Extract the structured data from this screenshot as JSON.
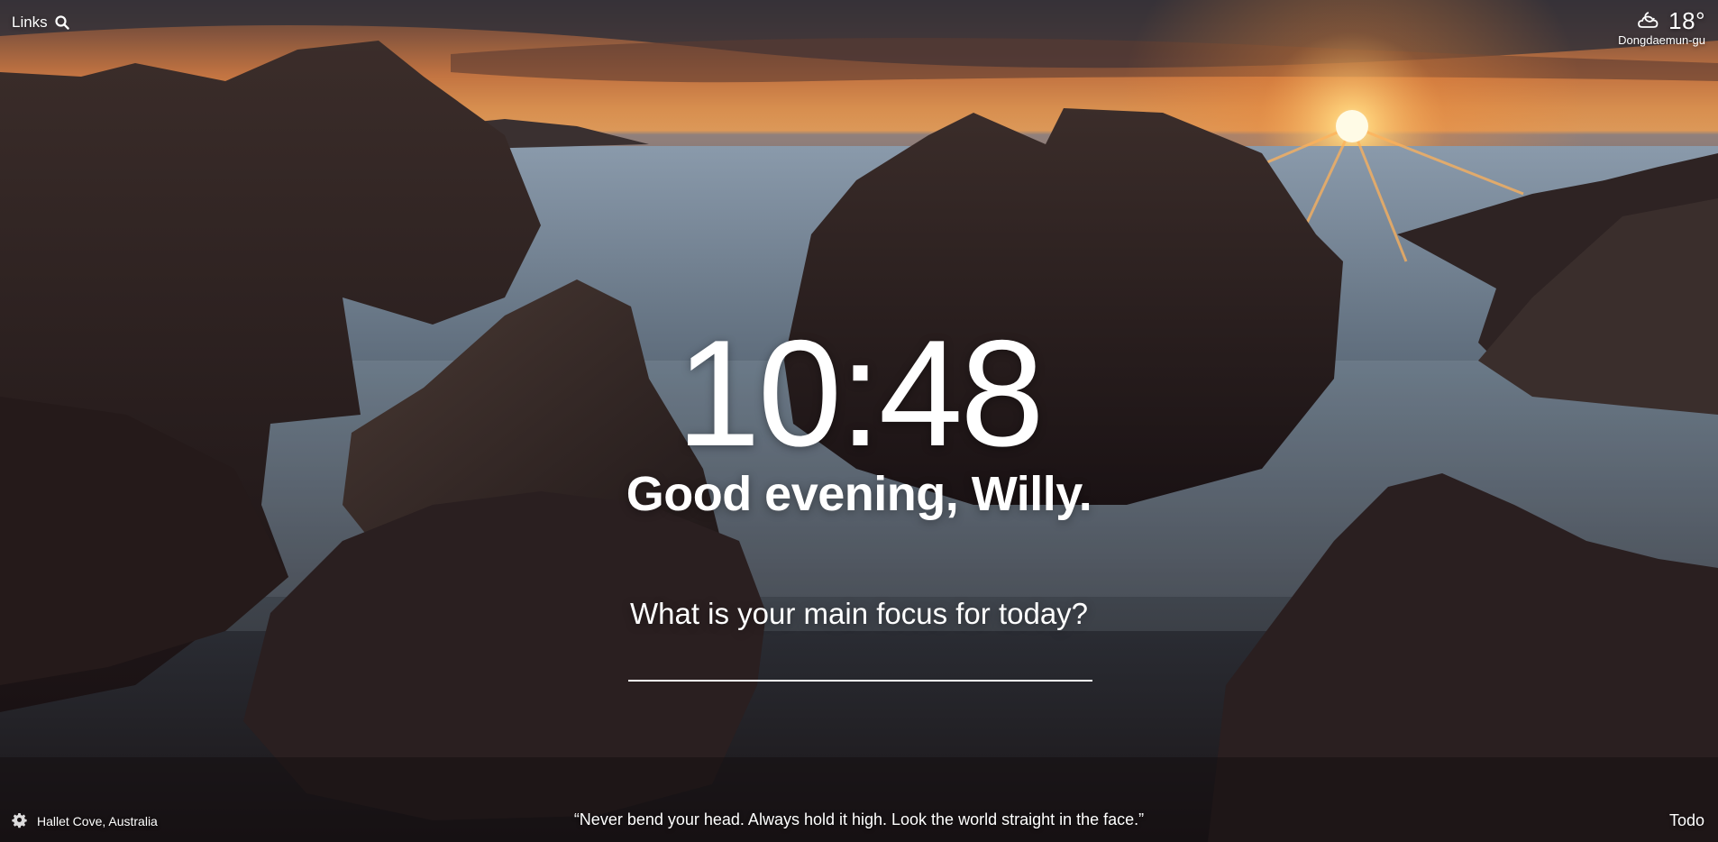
{
  "topbar": {
    "links_label": "Links",
    "search_icon": "search-icon"
  },
  "weather": {
    "icon": "cloud-moon-icon",
    "temperature": "18°",
    "location": "Dongdaemun-gu"
  },
  "main": {
    "time": "10:48",
    "greeting": "Good evening, Willy.",
    "focus_question": "What is your main focus for today?",
    "focus_value": ""
  },
  "footer": {
    "settings_icon": "gear-icon",
    "photo_location": "Hallet Cove, Australia",
    "quote": "“Never bend your head. Always hold it high. Look the world straight in the face.”",
    "todo_label": "Todo"
  },
  "colors": {
    "text": "#ffffff",
    "sky_glow": "#f0b168",
    "sun": "#fff2c0"
  }
}
